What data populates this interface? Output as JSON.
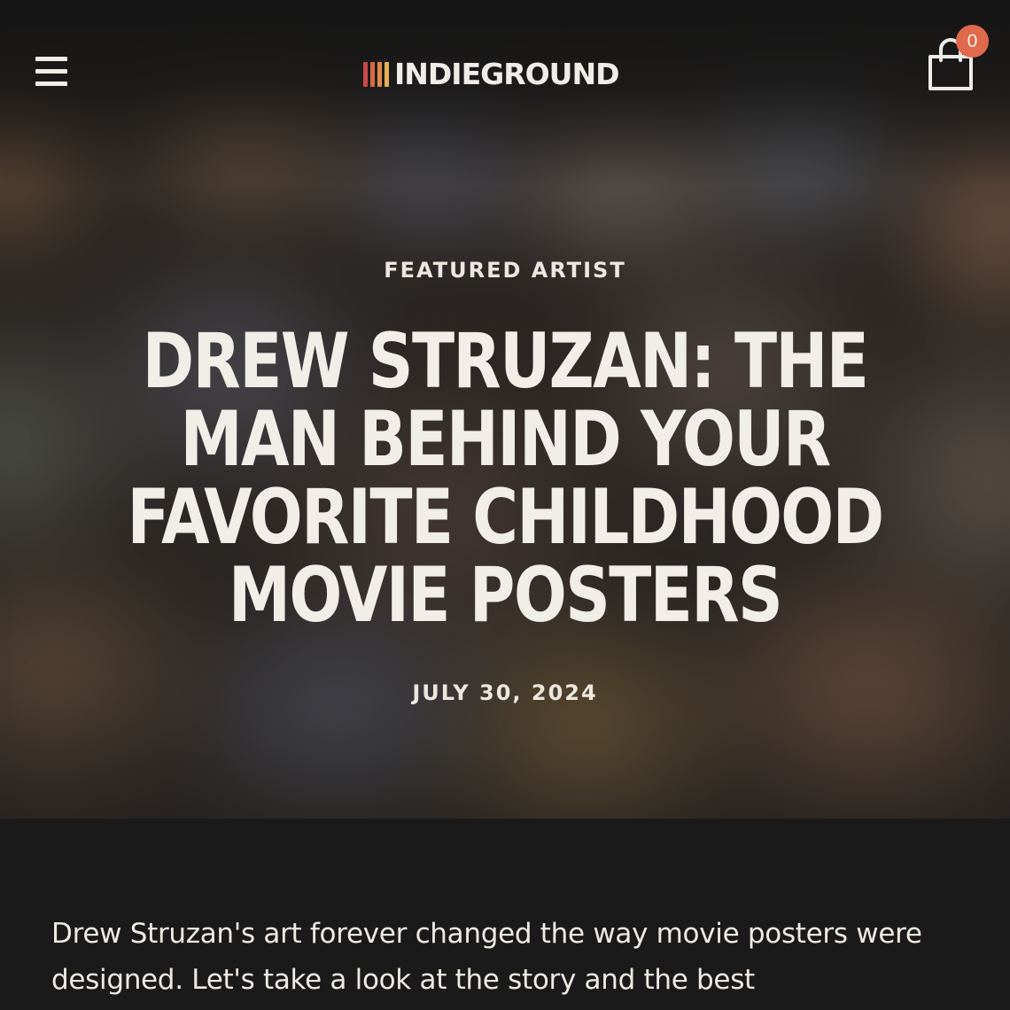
{
  "header": {
    "logo_text": "INDIEGROUND",
    "logo_stripe_colors": [
      "#c94a4a",
      "#d9693f",
      "#e08a45",
      "#e6b155"
    ],
    "cart_count": "0",
    "menu_icon": "hamburger-menu-icon",
    "cart_icon": "shopping-bag-icon"
  },
  "hero": {
    "category": "FEATURED ARTIST",
    "title": "DREW STRUZAN: THE MAN BEHIND YOUR FAVORITE CHILDHOOD MOVIE POSTERS",
    "date": "JULY 30, 2024"
  },
  "article": {
    "intro": "Drew Struzan's art forever changed the way movie posters were designed. Let's take a look at the story and the best"
  },
  "colors": {
    "page_background": "#1a1a1a",
    "text_light": "#f1ede7",
    "badge": "#e0694e"
  }
}
